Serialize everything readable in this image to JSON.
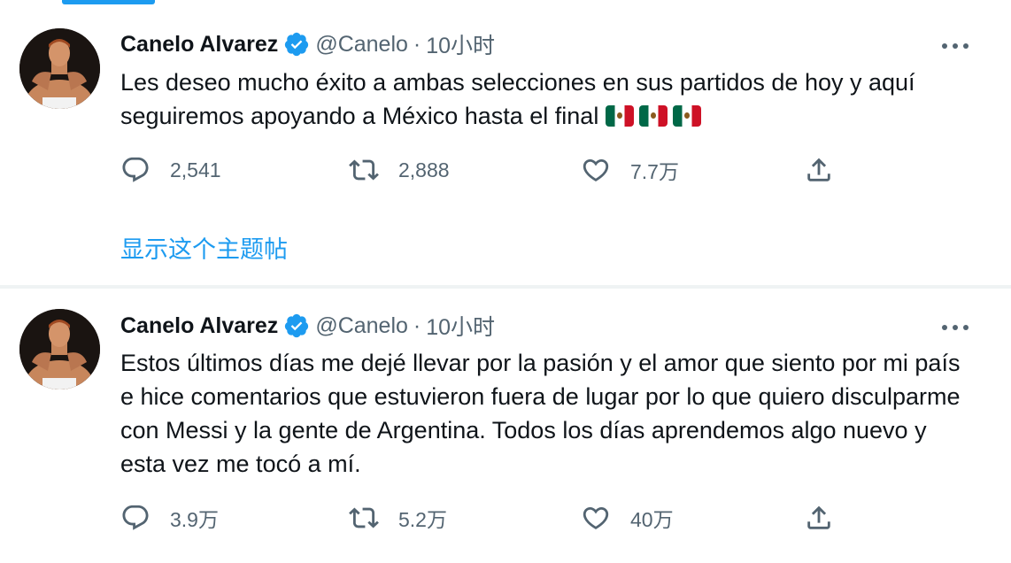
{
  "accent_color": "#1d9bf0",
  "tweets": [
    {
      "author": "Canelo Alvarez",
      "handle": "@Canelo",
      "separator": "·",
      "time": "10小时",
      "text": "Les deseo mucho éxito a ambas selecciones en sus partidos de hoy y aquí seguiremos apoyando a México hasta el final",
      "emojis": [
        "mexico-flag",
        "mexico-flag",
        "mexico-flag"
      ],
      "replies": "2,541",
      "retweets": "2,888",
      "likes": "7.7万",
      "show_thread": "显示这个主题帖"
    },
    {
      "author": "Canelo Alvarez",
      "handle": "@Canelo",
      "separator": "·",
      "time": "10小时",
      "text": "Estos últimos días me dejé llevar por la pasión y el amor que siento por mi país e hice comentarios que estuvieron fuera de lugar por lo que quiero disculparme con Messi y la gente de Argentina. Todos los días aprendemos algo nuevo y esta vez me tocó a mí.",
      "replies": "3.9万",
      "retweets": "5.2万",
      "likes": "40万"
    }
  ]
}
